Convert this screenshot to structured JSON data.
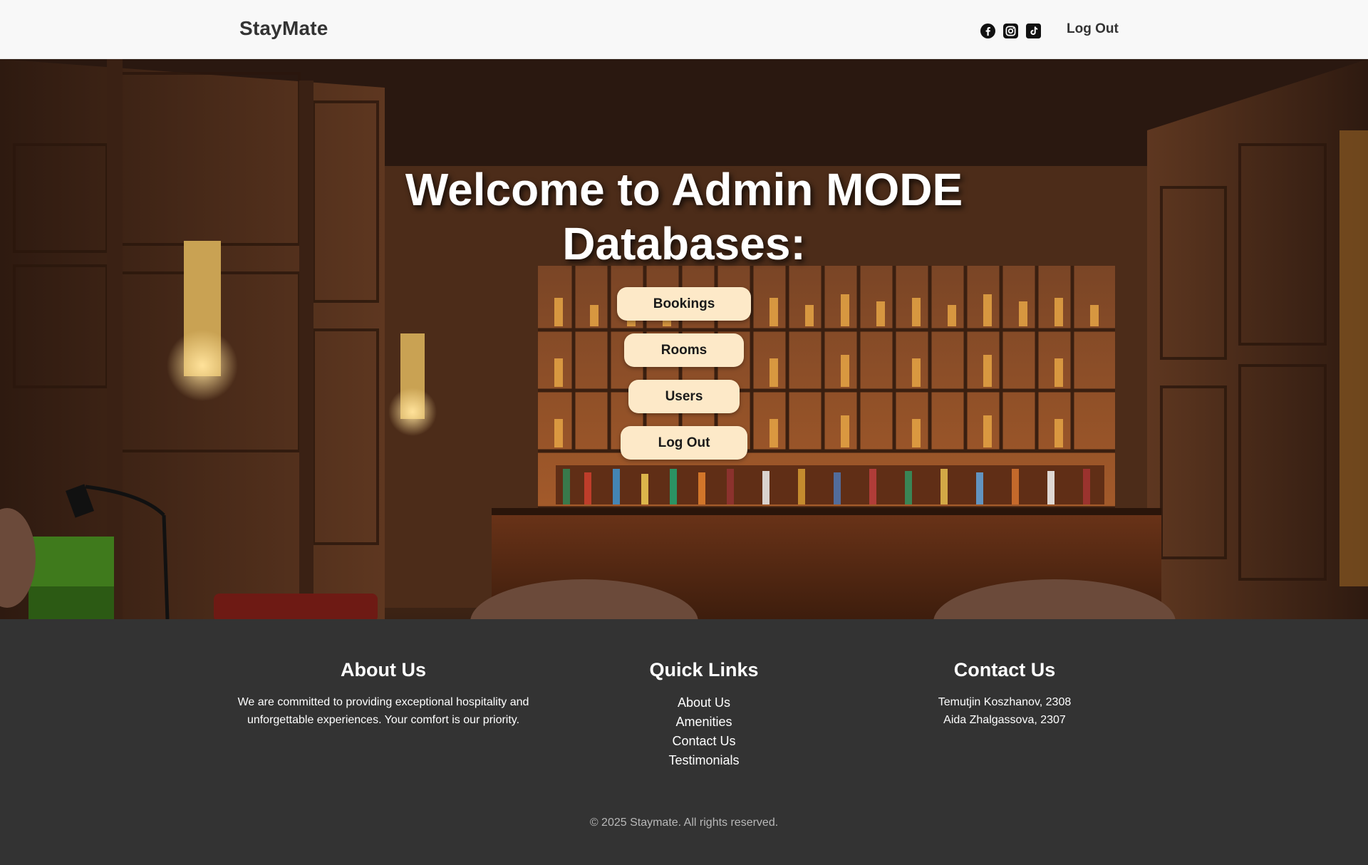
{
  "header": {
    "brand": "StayMate",
    "social_icons": [
      "facebook-icon",
      "instagram-icon",
      "tiktok-icon"
    ],
    "logout_label": "Log Out"
  },
  "hero": {
    "title": "Welcome to Admin MODE",
    "subtitle": "Databases:",
    "buttons": {
      "bookings": "Bookings",
      "rooms": "Rooms",
      "users": "Users",
      "logout": "Log Out"
    },
    "button_color": "#fde9c8"
  },
  "footer": {
    "about": {
      "heading": "About Us",
      "text": "We are committed to providing exceptional hospitality and unforgettable experiences. Your comfort is our priority."
    },
    "quick_links": {
      "heading": "Quick Links",
      "items": [
        "About Us",
        "Amenities",
        "Contact Us",
        "Testimonials"
      ]
    },
    "contact": {
      "heading": "Contact Us",
      "lines": [
        "Temutjin Koszhanov, 2308",
        "Aida Zhalgassova, 2307"
      ]
    },
    "copyright": "© 2025 Staymate. All rights reserved.",
    "background_color": "#333333"
  }
}
